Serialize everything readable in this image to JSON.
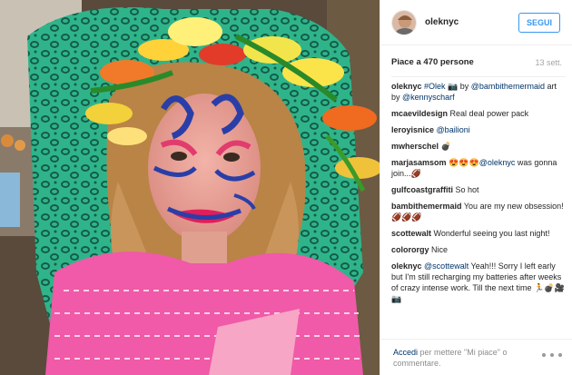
{
  "post": {
    "username": "oleknyc",
    "follow_label": "SEGUI",
    "likes": "Piace a 470 persone",
    "time_ago": "13 sett."
  },
  "comments": [
    {
      "author": "oleknyc",
      "parts": [
        {
          "t": "mention",
          "v": "#Olek"
        },
        {
          "t": "text",
          "v": " 📷 by "
        },
        {
          "t": "mention",
          "v": "@bambithemermaid"
        },
        {
          "t": "text",
          "v": " art by "
        },
        {
          "t": "mention",
          "v": "@kennyscharf"
        }
      ]
    },
    {
      "author": "mcaevildesign",
      "parts": [
        {
          "t": "text",
          "v": "Real deal power pack"
        }
      ]
    },
    {
      "author": "leroyisnice",
      "parts": [
        {
          "t": "mention",
          "v": "@bailioni"
        }
      ]
    },
    {
      "author": "mwherschel",
      "parts": [
        {
          "t": "text",
          "v": "💣"
        }
      ]
    },
    {
      "author": "marjasamsom",
      "parts": [
        {
          "t": "text",
          "v": "😍😍😍"
        },
        {
          "t": "mention",
          "v": "@oleknyc"
        },
        {
          "t": "text",
          "v": " was gonna join...🏈"
        }
      ]
    },
    {
      "author": "gulfcoastgraffiti",
      "parts": [
        {
          "t": "text",
          "v": "So hot"
        }
      ]
    },
    {
      "author": "bambithemermaid",
      "parts": [
        {
          "t": "text",
          "v": "You are my new obsession! 🏈🏈🏈"
        }
      ]
    },
    {
      "author": "scottewalt",
      "parts": [
        {
          "t": "text",
          "v": "Wonderful seeing you last night!"
        }
      ]
    },
    {
      "author": "colororgy",
      "parts": [
        {
          "t": "text",
          "v": "Nice"
        }
      ]
    },
    {
      "author": "oleknyc",
      "parts": [
        {
          "t": "mention",
          "v": "@scottewalt"
        },
        {
          "t": "text",
          "v": " Yeah!!! Sorry I left early but I'm still recharging my batteries after weeks of crazy intense work. Till the next time 🏃💣🎥📷"
        }
      ]
    }
  ],
  "footer": {
    "login_link": "Accedi",
    "login_text": " per mettere \"Mi piace\" o commentare."
  },
  "colors": {
    "accent": "#3897f0",
    "link": "#003569",
    "muted": "#a5a5a5"
  }
}
